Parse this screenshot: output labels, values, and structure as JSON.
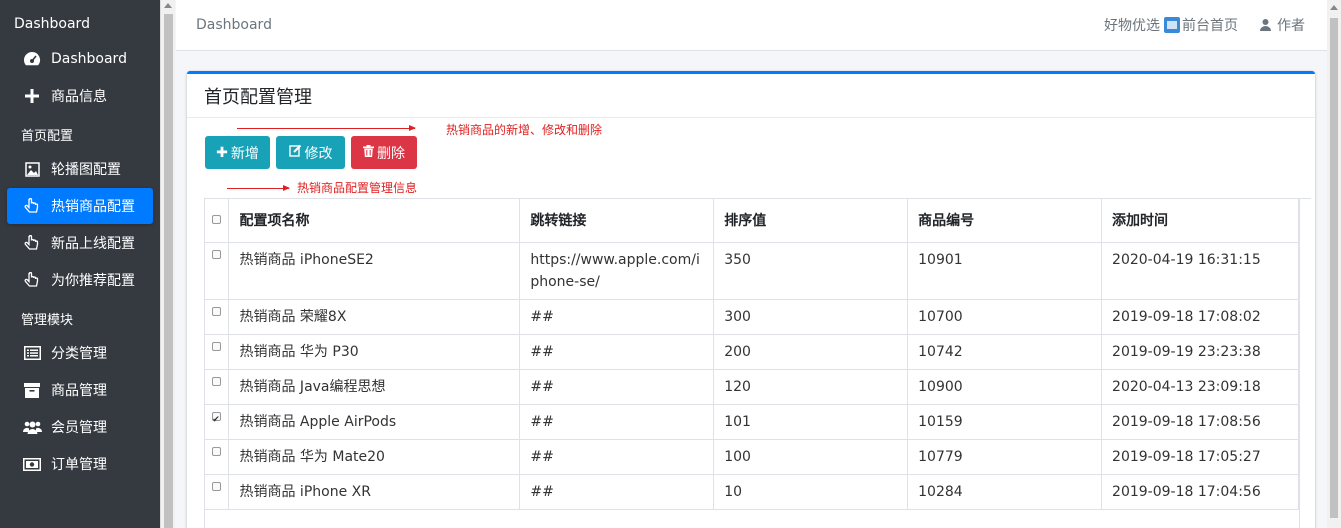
{
  "sidebar": {
    "title": "Dashboard",
    "top_items": [
      {
        "label": "Dashboard",
        "icon": "dashboard-icon"
      },
      {
        "label": "商品信息",
        "icon": "plus-icon"
      }
    ],
    "groups": [
      {
        "header": "首页配置",
        "items": [
          {
            "label": "轮播图配置",
            "icon": "image-icon",
            "active": false
          },
          {
            "label": "热销商品配置",
            "icon": "hand-pointer-icon",
            "active": true
          },
          {
            "label": "新品上线配置",
            "icon": "hand-pointer-icon",
            "active": false
          },
          {
            "label": "为你推荐配置",
            "icon": "hand-pointer-icon",
            "active": false
          }
        ]
      },
      {
        "header": "管理模块",
        "items": [
          {
            "label": "分类管理",
            "icon": "list-icon"
          },
          {
            "label": "商品管理",
            "icon": "archive-icon"
          },
          {
            "label": "会员管理",
            "icon": "users-icon"
          },
          {
            "label": "订单管理",
            "icon": "money-icon"
          }
        ]
      }
    ]
  },
  "topbar": {
    "breadcrumb": "Dashboard",
    "shop_link": "好物优选",
    "home_link": "前台首页",
    "author": "作者"
  },
  "card": {
    "title": "首页配置管理",
    "annotation_buttons": "热销商品的新增、修改和删除",
    "annotation_table": "热销商品配置管理信息",
    "buttons": {
      "add": "新增",
      "edit": "修改",
      "delete": "删除"
    }
  },
  "table": {
    "headers": [
      "配置项名称",
      "跳转链接",
      "排序值",
      "商品编号",
      "添加时间"
    ],
    "rows": [
      {
        "name": "热销商品 iPhoneSE2",
        "link": "https://www.apple.com/iphone-se/",
        "sort": "350",
        "goods_id": "10901",
        "time": "2020-04-19 16:31:15",
        "checked": false
      },
      {
        "name": "热销商品 荣耀8X",
        "link": "##",
        "sort": "300",
        "goods_id": "10700",
        "time": "2019-09-18 17:08:02",
        "checked": false
      },
      {
        "name": "热销商品 华为 P30",
        "link": "##",
        "sort": "200",
        "goods_id": "10742",
        "time": "2019-09-19 23:23:38",
        "checked": false
      },
      {
        "name": "热销商品 Java编程思想",
        "link": "##",
        "sort": "120",
        "goods_id": "10900",
        "time": "2020-04-13 23:09:18",
        "checked": false
      },
      {
        "name": "热销商品 Apple AirPods",
        "link": "##",
        "sort": "101",
        "goods_id": "10159",
        "time": "2019-09-18 17:08:56",
        "checked": true
      },
      {
        "name": "热销商品 华为 Mate20",
        "link": "##",
        "sort": "100",
        "goods_id": "10779",
        "time": "2019-09-18 17:05:27",
        "checked": false
      },
      {
        "name": "热销商品 iPhone XR",
        "link": "##",
        "sort": "10",
        "goods_id": "10284",
        "time": "2019-09-18 17:04:56",
        "checked": false
      }
    ]
  }
}
